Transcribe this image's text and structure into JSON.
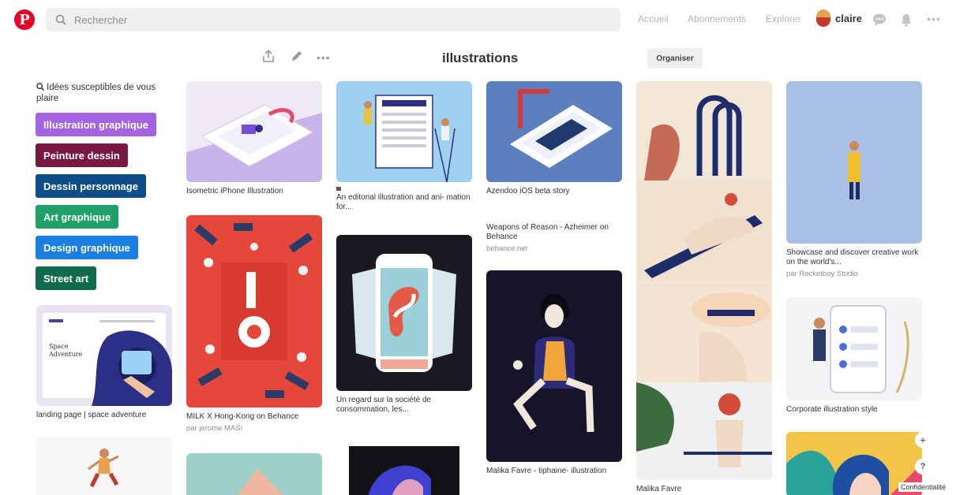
{
  "header": {
    "logo": "P",
    "search_placeholder": "Rechercher",
    "nav_home": "Accueil",
    "nav_subscriptions": "Abonnements",
    "nav_explore": "Explorer",
    "user_name": "claire"
  },
  "board": {
    "title": "illustrations",
    "organise_label": "Organiser"
  },
  "ideas": {
    "heading": "Idées susceptibles de vous plaire",
    "chips": [
      {
        "label": "Illustration graphique",
        "color": "#a463e0"
      },
      {
        "label": "Peinture dessin",
        "color": "#7a1740"
      },
      {
        "label": "Dessin personnage",
        "color": "#0f4d8a"
      },
      {
        "label": "Art graphique",
        "color": "#1fa067"
      },
      {
        "label": "Design graphique",
        "color": "#1a7fe0"
      },
      {
        "label": "Street art",
        "color": "#0f6b4a"
      }
    ]
  },
  "pins": {
    "landing": {
      "title": "landing page | space adventure",
      "caption_title": "Space Adventure"
    },
    "iphone": {
      "title": "Isometric iPhone Illustration"
    },
    "milk": {
      "title": "MILK X Hong-Kong on Behance",
      "sub": "par jerome MASI"
    },
    "editorial": {
      "title": "An editorial illustration and ani- mation for..."
    },
    "regard": {
      "title": "Un regard sur la société de consommation, les..."
    },
    "azendoo": {
      "title": "Azendoo iOS beta story"
    },
    "weapons": {
      "title": "Weapons of Reason - Azheimer on Behance",
      "sub": "behance.net"
    },
    "malika_tiphaine": {
      "title": "Malika Favre - tiphaine- illustration"
    },
    "malika": {
      "title": "Malika Favre"
    },
    "showcase": {
      "title": "Showcase and discover creative work on the world's...",
      "sub": "par Rocketboy Studio"
    },
    "corporate": {
      "title": "Corporate illustration style"
    }
  },
  "footer": {
    "plus": "+",
    "help": "?",
    "privacy": "Confidentialité"
  },
  "colors": {
    "brand": "#e60023",
    "search_bg": "#efefef"
  }
}
